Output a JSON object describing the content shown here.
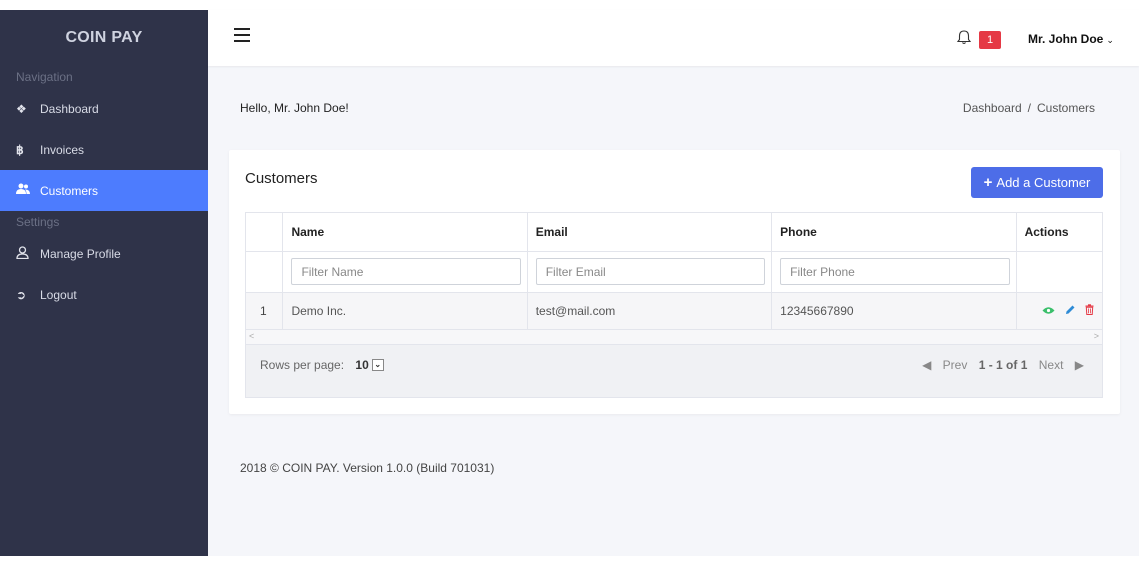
{
  "brand": "COIN PAY",
  "sidebar": {
    "sections": [
      {
        "label": "Navigation"
      },
      {
        "label": "Settings"
      }
    ],
    "items": [
      {
        "label": "Dashboard",
        "icon": "home-icon"
      },
      {
        "label": "Invoices",
        "icon": "bitcoin-icon"
      },
      {
        "label": "Customers",
        "icon": "users-icon",
        "active": true
      },
      {
        "label": "Manage Profile",
        "icon": "user-icon"
      },
      {
        "label": "Logout",
        "icon": "sign-out-icon"
      }
    ]
  },
  "header": {
    "notification_count": "1",
    "user_name": "Mr. John Doe"
  },
  "greeting": "Hello, Mr. John Doe!",
  "breadcrumb": [
    "Dashboard",
    "Customers"
  ],
  "card": {
    "title": "Customers",
    "add_button_label": "Add a Customer"
  },
  "table": {
    "columns": [
      "Name",
      "Email",
      "Phone",
      "Actions"
    ],
    "filters": {
      "name_placeholder": "Filter Name",
      "email_placeholder": "Filter Email",
      "phone_placeholder": "Filter Phone"
    },
    "rows": [
      {
        "index": "1",
        "name": "Demo Inc.",
        "email": "test@mail.com",
        "phone": "12345667890"
      }
    ],
    "pagination": {
      "rows_per_page_label": "Rows per page:",
      "rows_per_page": "10",
      "prev_label": "Prev",
      "range": "1 - 1 of 1",
      "next_label": "Next"
    }
  },
  "footer": "2018 © COIN PAY.   Version 1.0.0 (Build 701031)",
  "colors": {
    "sidebar_bg": "#2f3349",
    "accent": "#4d7cfe",
    "button": "#4d6de8",
    "badge": "#e53945",
    "view_icon": "#3bbf6b",
    "edit_icon": "#2e8bd6",
    "delete_icon": "#e53945"
  }
}
